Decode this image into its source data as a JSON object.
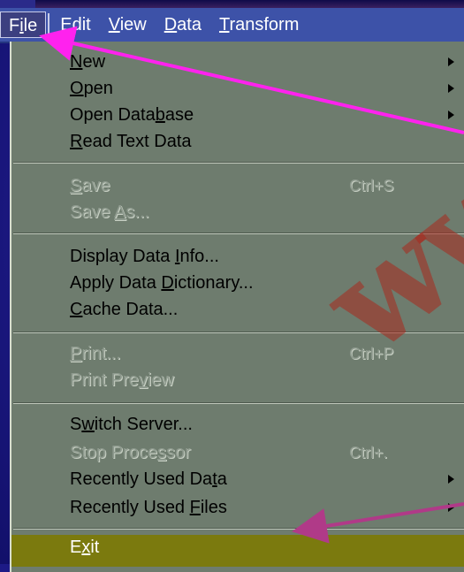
{
  "menubar": {
    "items": [
      {
        "label": "File",
        "underline": "i",
        "active": true
      },
      {
        "label": "Edit",
        "underline": "E"
      },
      {
        "label": "View",
        "underline": "V"
      },
      {
        "label": "Data",
        "underline": "D"
      },
      {
        "label": "Transform",
        "underline": "T"
      }
    ]
  },
  "file_menu": {
    "items": [
      {
        "label": "New",
        "submenu": true,
        "enabled": true
      },
      {
        "label": "Open",
        "submenu": true,
        "enabled": true
      },
      {
        "label": "Open Database",
        "submenu": true,
        "enabled": true
      },
      {
        "label": "Read Text Data",
        "submenu": false,
        "enabled": true
      },
      {
        "label": "Save",
        "shortcut": "Ctrl+S",
        "enabled": false
      },
      {
        "label": "Save As...",
        "enabled": false
      },
      {
        "label": "Display Data Info...",
        "enabled": true
      },
      {
        "label": "Apply Data Dictionary...",
        "enabled": true
      },
      {
        "label": "Cache Data...",
        "enabled": true
      },
      {
        "label": "Print...",
        "shortcut": "Ctrl+P",
        "enabled": false
      },
      {
        "label": "Print Preview",
        "enabled": false
      },
      {
        "label": "Switch Server...",
        "enabled": true
      },
      {
        "label": "Stop Processor",
        "shortcut": "Ctrl+.",
        "enabled": false
      },
      {
        "label": "Recently Used Data",
        "submenu": true,
        "enabled": true
      },
      {
        "label": "Recently Used Files",
        "submenu": true,
        "enabled": true
      },
      {
        "label": "Exit",
        "enabled": true,
        "highlighted": true
      }
    ]
  },
  "watermark": {
    "text": "ww"
  },
  "colors": {
    "menubar": "#3d52a8",
    "menu_bg": "#6e7c6e",
    "highlight": "#7b7a0e",
    "annotation_arrow": "#ff22ee",
    "annotation_arrow_dark": "#b03a88",
    "slide_bg": "#1d1a86"
  }
}
